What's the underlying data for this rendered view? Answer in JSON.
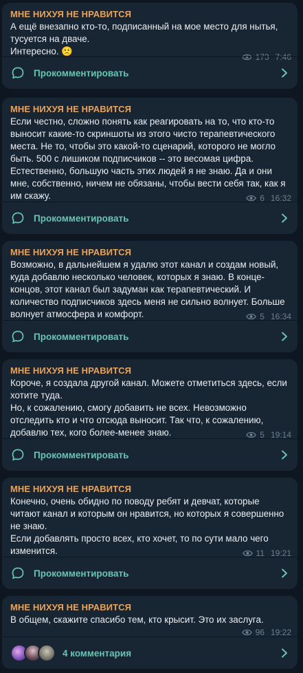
{
  "posts": [
    {
      "author": "МНЕ НИХУЯ НЕ НРАВИТСЯ",
      "text": "А ещё внезапно кто-то, подписанный на мое место для нытья, тусуется на дваче.\nИнтересно. 🙁",
      "views": "173",
      "time": "7:46",
      "comment_label": "Прокомментировать"
    },
    {
      "author": "МНЕ НИХУЯ НЕ НРАВИТСЯ",
      "text": "Если честно, сложно понять как реагировать на то, что кто-то выносит какие-то скриншоты из этого чисто терапевтического места. Не то, чтобы это какой-то сценарий, которого не могло быть. 500 с лишиком подписчиков -- это весомая цифра. Естественно, большую часть этих людей я не знаю. Да и они мне, собственно, ничем не обязаны, чтобы вести себя так, как я им скажу.",
      "views": "6",
      "time": "16:32",
      "comment_label": "Прокомментировать"
    },
    {
      "author": "МНЕ НИХУЯ НЕ НРАВИТСЯ",
      "text": "Возможно, в дальнейшем я удалю этот канал и создам новый, куда добавлю несколько человек, которых я знаю. В конце-концов, этот канал был задуман как терапевтический. И количество подписчиков здесь меня не сильно волнует. Больше волнует атмосфера и комфорт.",
      "views": "5",
      "time": "16:34",
      "comment_label": "Прокомментировать"
    },
    {
      "author": "МНЕ НИХУЯ НЕ НРАВИТСЯ",
      "text": "Короче, я создала другой канал. Можете отметиться здесь, если хотите туда.\nНо, к сожалению, смогу добавить не всех. Невозможно отследить кто и что отсюда выносит. Так что, к сожалению, добавлю тех, кого более-менее знаю.",
      "views": "5",
      "time": "19:14",
      "comment_label": "Прокомментировать"
    },
    {
      "author": "МНЕ НИХУЯ НЕ НРАВИТСЯ",
      "text": "Конечно, очень обидно по поводу ребят и девчат, которые читают канал и которым он нравится, но которых я совершенно не знаю.\nЕсли добавлять просто всех, кто хочет, то по сути мало чего изменится.",
      "views": "11",
      "time": "19:21",
      "comment_label": "Прокомментировать"
    },
    {
      "author": "МНЕ НИХУЯ НЕ НРАВИТСЯ",
      "text": "В общем, скажите спасибо тем, кто крысит. Это их заслуга.",
      "views": "96",
      "time": "19:22",
      "comment_label": "4 комментария"
    }
  ],
  "colors": {
    "background": "#0e1621",
    "bubble": "#182533",
    "author": "#e8a35c",
    "text": "#e9eef3",
    "meta": "#6d7f8f",
    "comment_link": "#67c5b2"
  },
  "icons": {
    "views": "eye-icon",
    "comment": "comment-bubble-icon",
    "open": "chevron-right-icon"
  }
}
